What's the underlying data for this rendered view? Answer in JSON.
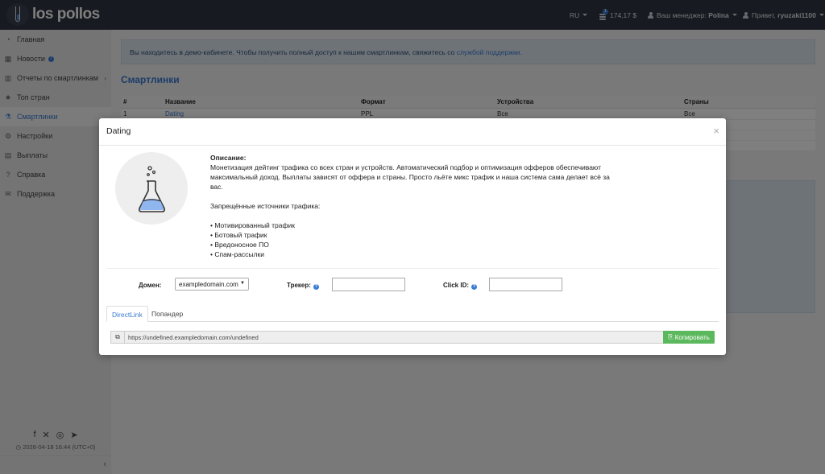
{
  "brand": {
    "name": "los pollos"
  },
  "header": {
    "lang": "RU",
    "balance": "174,17 $",
    "balance_badge": "1",
    "manager_label": "Ваш менеджер:",
    "manager_name": "Polina",
    "greeting": "Привет,",
    "username": "ryuzaki1100"
  },
  "sidebar": {
    "items": [
      {
        "label": "Главная",
        "icon": "dashboard-icon"
      },
      {
        "label": "Новости",
        "icon": "calendar-icon",
        "info": "!"
      },
      {
        "label": "Отчеты по смартлинкам",
        "icon": "chart-icon"
      },
      {
        "label": "Топ стран",
        "icon": "star-icon"
      },
      {
        "label": "Смартлинки",
        "icon": "flask-icon"
      },
      {
        "label": "Настройки",
        "icon": "gear-icon"
      },
      {
        "label": "Выплаты",
        "icon": "wallet-icon"
      },
      {
        "label": "Справка",
        "icon": "question-icon"
      },
      {
        "label": "Поддержка",
        "icon": "envelope-icon"
      }
    ],
    "datetime": "2026-04-18 16:44 (UTC+0)"
  },
  "main": {
    "notice_text": "Вы находитесь в демо-кабинете. Чтобы получить полный доступ к нашим смартлинкам, свяжитесь со",
    "notice_link": "службой поддержки.",
    "title": "Смартлинки",
    "table": {
      "headers": [
        "#",
        "Название",
        "Формат",
        "Устройства",
        "Страны"
      ],
      "rows": [
        [
          "1",
          "Dating",
          "PPL",
          "Все",
          "Все"
        ]
      ]
    }
  },
  "modal": {
    "title": "Dating",
    "close": "×",
    "description_label": "Описание:",
    "description": "Монетизация дейтинг трафика со всех стран и устройств. Автоматический подбор и оптимизация офферов обеспечивают максимальный доход. Выплаты зависят от оффера и страны. Просто льёте микс трафик и наша система сама делает всё за вас.",
    "forbidden_title": "Запрещённые источники трафика:",
    "forbidden": [
      "• Мотивированный трафик",
      "• Ботовый трафик",
      "• Вредоносное ПО",
      "• Спам-рассылки"
    ],
    "domain_label": "Домен:",
    "domain_value": "exampledomain.com",
    "tracker_label": "Трекер:",
    "clickid_label": "Click ID:",
    "tabs": [
      "DirectLink",
      "Попандер"
    ],
    "url": "https://undefined.exampledomain.com/undefined",
    "copy_label": "Копировать"
  },
  "colors": {
    "accent": "#3a7bd5",
    "topbar": "#2e3440",
    "copy": "#5cb85c"
  }
}
